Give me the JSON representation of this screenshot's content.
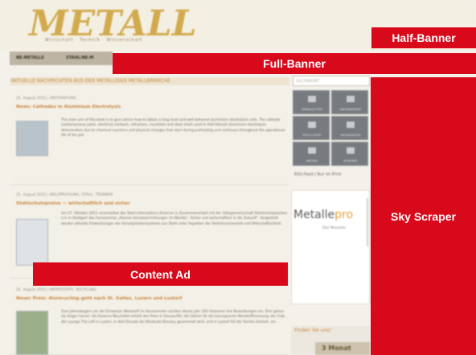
{
  "header": {
    "logo_text": "METALL",
    "logo_tagline": "Wirtschaft · Technik · Wissenschaft"
  },
  "nav": {
    "items": [
      "NE-METALLE",
      "STAHL/NE-M"
    ]
  },
  "section": {
    "title": "AKTUELLE NACHRICHTEN AUS DER METALLIGEN METALLBRANCHE"
  },
  "articles": [
    {
      "date": "21. August 2015 | ABSTRAKTUNG",
      "title": "News: Cathodes in Aluminium Electrolysis",
      "body": "The main aim of this book is to give advice how to obtain a long-lived and well behaved aluminium electrolysis cells. The cathode (carbonaceous parts, electrical contacts, refractory, insulation and steel shell) used in Hall-Héroult aluminium electrolysis deterioration due to chemical reactions and physical changes that start during preheating and continues throughout the operational life of the pot."
    },
    {
      "date": "21. August 2015 | WALZPROFILING, STAHL, TRENNEN",
      "title": "Stahlschutzpreise — wirtschaftlich und sicher",
      "body": "Am 27. Oktober 2015 veranstaltet das Stahl-Informations-Zentrum in Zusammenarbeit mit der Gütegemeinschaft Stahlschutzplanken e.V. in Stuttgart das Fachseminar „Passive Schutzeinrichtungen im Wandel – Sicher und wirtschaftlich in die Zukunft\". Vorgestellt werden aktuelle Entwicklungen der Schutzplankensysteme aus Stahl unter Aspekten der Verkehrssicherheit und Wirtschaftlichkeit."
    },
    {
      "date": "21. August 2015 | WERTSTOFFE, RECYCLING",
      "title": "Neuer Preis: Alurecycling geht nach St. Gallen, Luzern und Lustorf",
      "body": "Zum Jahresbeginn um die Schweizer Wertstoff im Alusammeln reichten dieses Jahr 203 Aluteams ihre Bewerbungen ein. Drei gehen als Sieger hervor: die Kaserne Neuchâtel erhielt den Preis in Gossau/SG, die Gärten für die konsequente Wertstofftrennung, der Club der Lounge The Loft in Luzern, in dem Einsatz der Bierbude Dorszny gesammelt wird, und in Lustorf SO die Familie Gerhart, ein"
    }
  ],
  "sidebar": {
    "search_placeholder": "SUCHWORT",
    "tiles": [
      "NEWSLETTER",
      "ABONNEMENT",
      "BUCH SHOP",
      "MEDIADATEN",
      "ARCHIV",
      "KONTAKT"
    ],
    "rss_text": "RSS-Feed  |  Nur im Print",
    "promo_title_part1": "Metalle",
    "promo_title_part2": "pro",
    "promo_subtitle": "Das Neueste",
    "bottom_widget_title": "Finden Sie uns!",
    "bottom_widget_tab": "3 Monat"
  },
  "ad_slots": {
    "half_banner": "Half-Banner",
    "full_banner": "Full-Banner",
    "sky_scraper": "Sky Scraper",
    "content_ad": "Content Ad"
  },
  "colors": {
    "ad_red": "#d7091b",
    "logo_gold": "#d2aa4e",
    "headline_orange": "#c9853a",
    "tile_grey": "#777b80"
  }
}
